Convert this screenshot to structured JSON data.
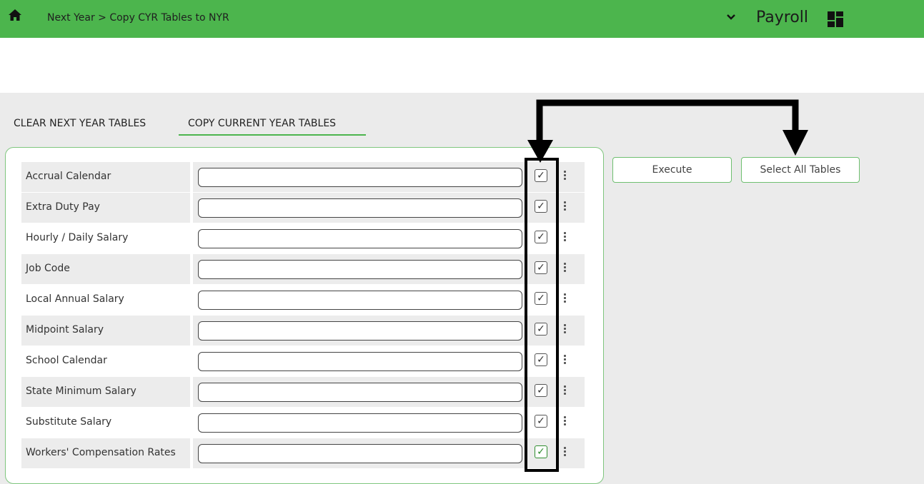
{
  "header": {
    "breadcrumb": "Next Year > Copy CYR Tables to NYR",
    "app_name": "Payroll",
    "brand_color": "#4cb54d"
  },
  "tabs": [
    {
      "label": "CLEAR NEXT YEAR TABLES",
      "active": false
    },
    {
      "label": "COPY CURRENT YEAR TABLES",
      "active": true
    }
  ],
  "tables": [
    {
      "label": "Accrual Calendar",
      "value": "",
      "checked": true
    },
    {
      "label": "Extra Duty Pay",
      "value": "",
      "checked": true
    },
    {
      "label": "Hourly / Daily Salary",
      "value": "",
      "checked": true
    },
    {
      "label": "Job Code",
      "value": "",
      "checked": true
    },
    {
      "label": "Local Annual Salary",
      "value": "",
      "checked": true
    },
    {
      "label": "Midpoint Salary",
      "value": "",
      "checked": true
    },
    {
      "label": "School Calendar",
      "value": "",
      "checked": true
    },
    {
      "label": "State Minimum Salary",
      "value": "",
      "checked": true
    },
    {
      "label": "Substitute Salary",
      "value": "",
      "checked": true
    },
    {
      "label": "Workers' Compensation Rates",
      "value": "",
      "checked": true
    }
  ],
  "buttons": {
    "execute": "Execute",
    "select_all": "Select All Tables"
  },
  "icons": {
    "home": "home-icon",
    "chevron": "chevron-down-icon",
    "apps": "app-grid-icon",
    "checkbox": "check-icon",
    "row_menu": "kebab-icon"
  }
}
